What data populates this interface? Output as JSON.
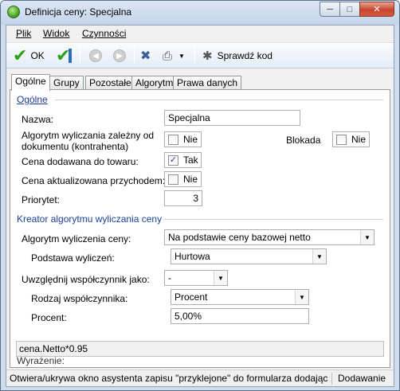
{
  "window": {
    "title": "Definicja ceny: Specjalna"
  },
  "menu": {
    "items": [
      {
        "label": "Plik"
      },
      {
        "label": "Widok"
      },
      {
        "label": "Czynności"
      }
    ]
  },
  "toolbar": {
    "ok_label": "OK",
    "check_label": "Sprawdź kod"
  },
  "tabs": [
    {
      "label": "Ogólne",
      "active": true
    },
    {
      "label": "Grupy"
    },
    {
      "label": "Pozostałe"
    },
    {
      "label": "Algorytm"
    },
    {
      "label": "Prawa danych"
    }
  ],
  "general": {
    "section_title": "Ogólne",
    "name_label": "Nazwa:",
    "name_value": "Specjalna",
    "algorithm_label_line1": "Algorytm wyliczania zależny od",
    "algorithm_label_line2": "dokumentu (kontrahenta)",
    "algorithm_value": "Nie",
    "block_label": "Blokada",
    "block_value": "Nie",
    "added_label": "Cena dodawana do towaru:",
    "added_value": "Tak",
    "updated_label": "Cena aktualizowana przychodem:",
    "updated_value": "Nie",
    "priority_label": "Priorytet:",
    "priority_value": "3"
  },
  "wizard": {
    "section_title": "Kreator algorytmu wyliczania ceny",
    "algorithm_label": "Algorytm wyliczenia ceny:",
    "algorithm_value": "Na podstawie ceny bazowej netto",
    "basis_label": "Podstawa wyliczeń:",
    "basis_value": "Hurtowa",
    "coef_label": "Uwzględnij współczynnik jako:",
    "coef_value": "-",
    "coef_type_label": "Rodzaj współczynnika:",
    "coef_type_value": "Procent",
    "percent_label": "Procent:",
    "percent_value": "5,00%"
  },
  "expression": {
    "label": "Wyrażenie:",
    "value": "cena.Netto*0.95"
  },
  "status": {
    "message": "Otwiera/ukrywa okno asystenta zapisu \"przyklejone\" do formularza dodając",
    "mode": "Dodawanie"
  }
}
